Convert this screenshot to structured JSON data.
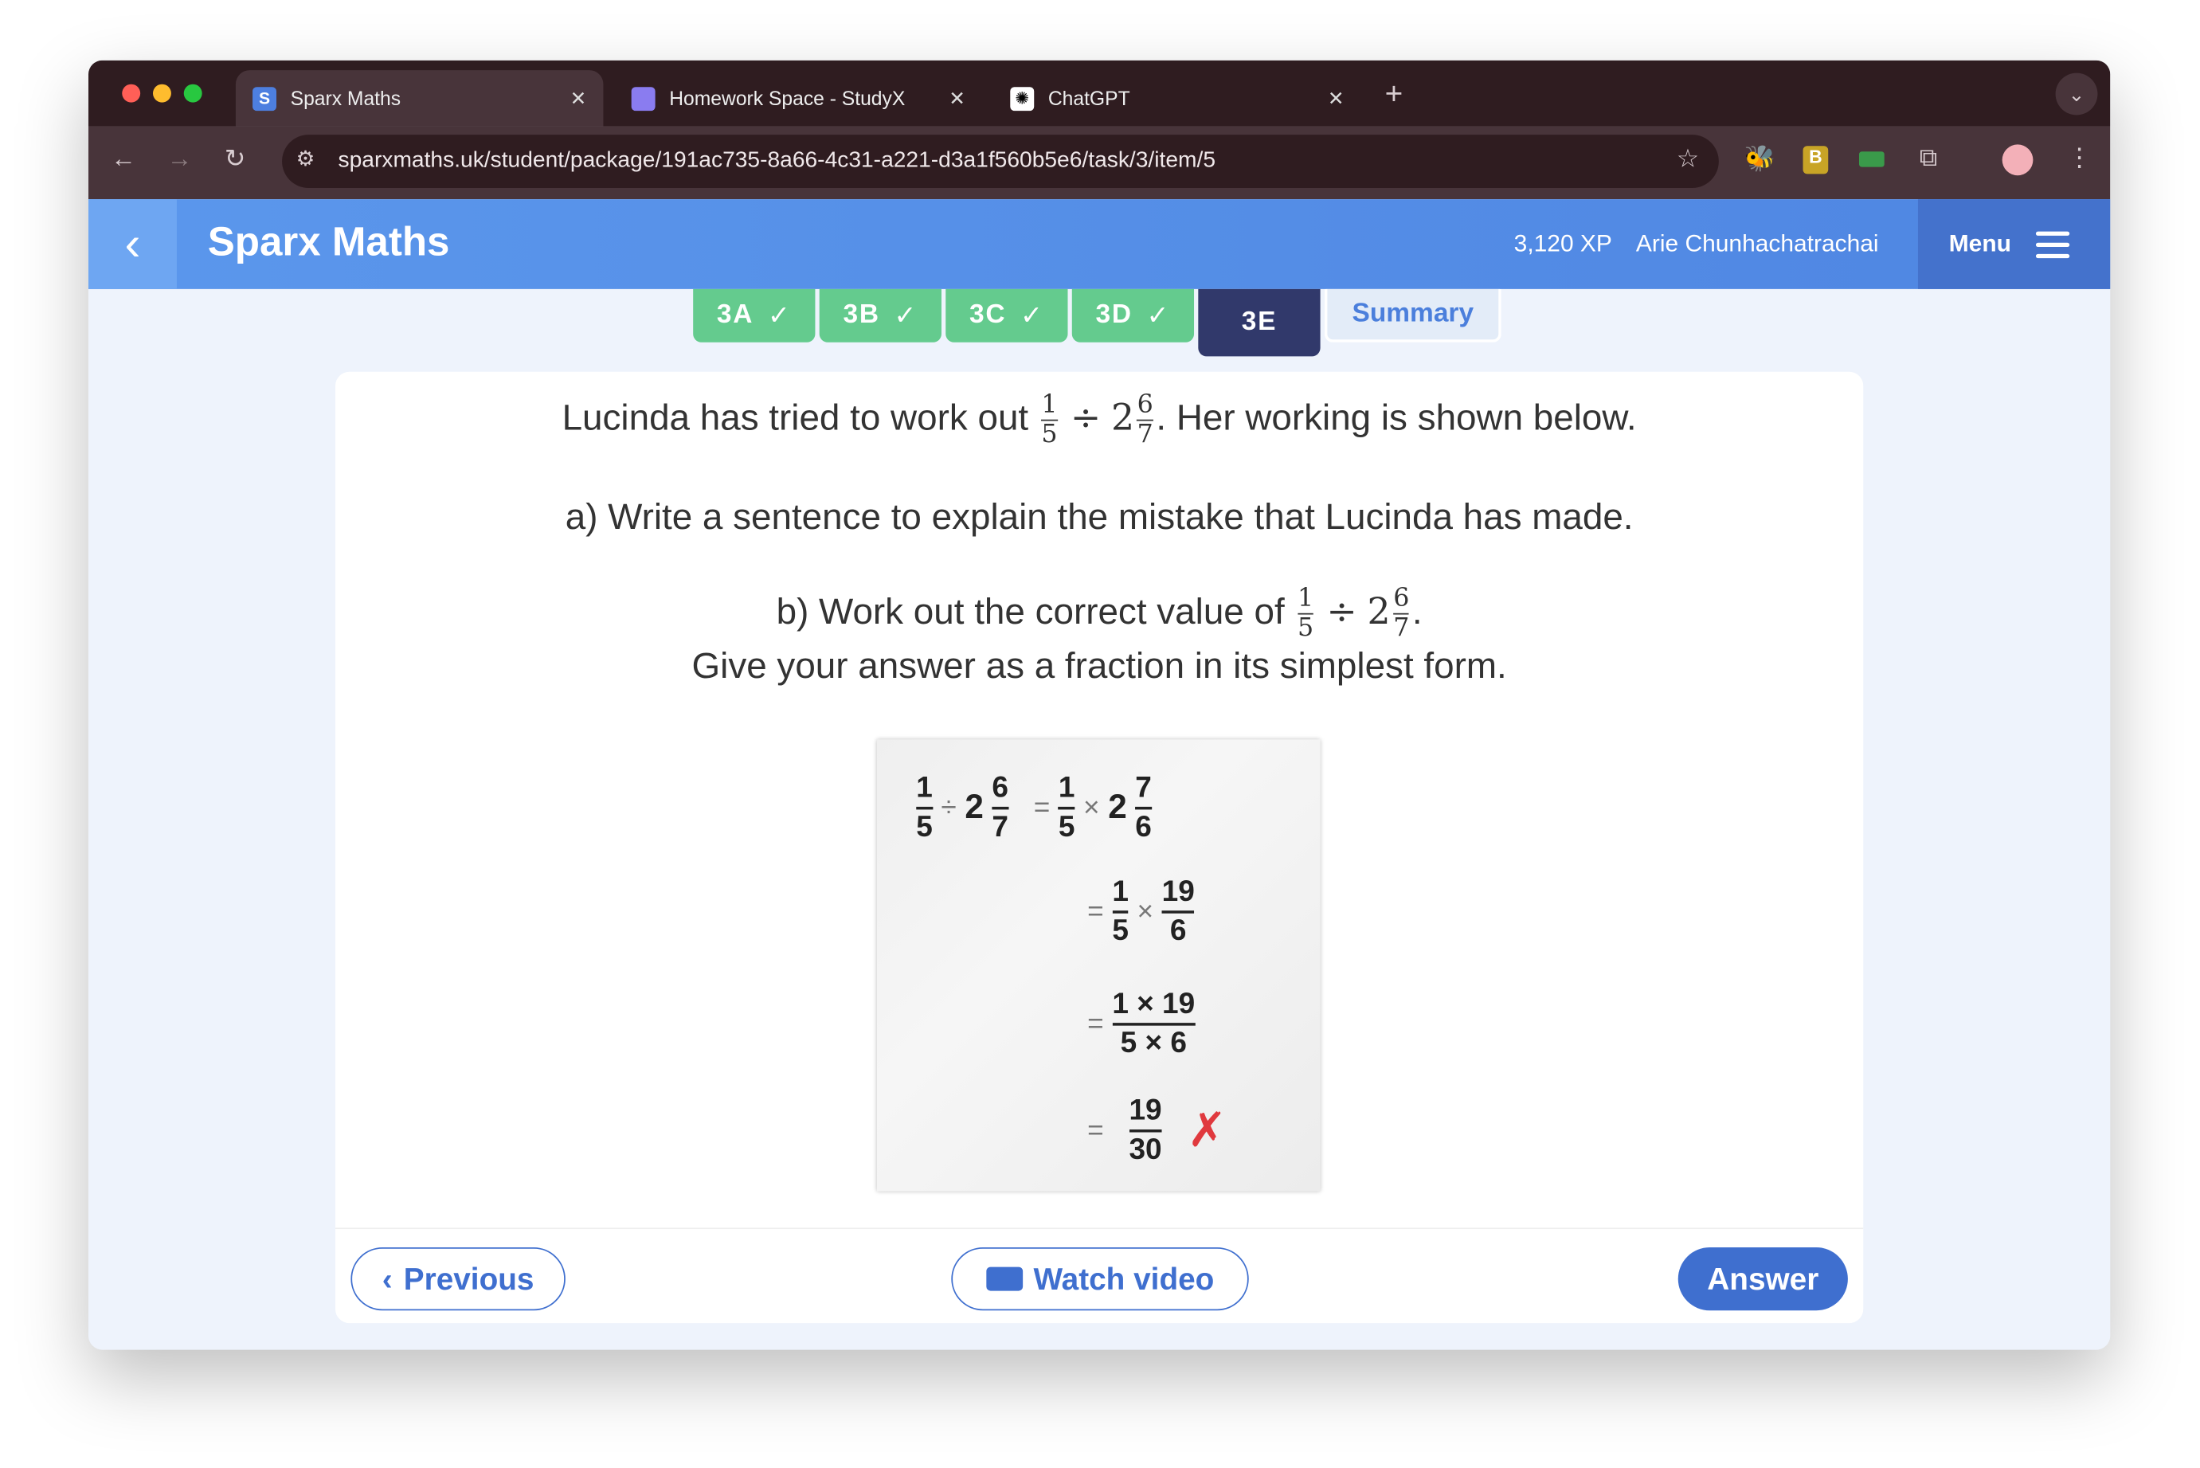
{
  "browser": {
    "tabs": [
      {
        "title": "Sparx Maths",
        "favicon": "S"
      },
      {
        "title": "Homework Space - StudyX"
      },
      {
        "title": "ChatGPT"
      }
    ],
    "url": "sparxmaths.uk/student/package/191ac735-8a66-4c31-a221-d3a1f560b5e6/task/3/item/5"
  },
  "header": {
    "title": "Sparx Maths",
    "xp": "3,120 XP",
    "user": "Arie Chunhachatrachai",
    "menu": "Menu"
  },
  "steps": [
    {
      "label": "3A",
      "done": true
    },
    {
      "label": "3B",
      "done": true
    },
    {
      "label": "3C",
      "done": true
    },
    {
      "label": "3D",
      "done": true
    },
    {
      "label": "3E",
      "current": true
    },
    {
      "label": "Summary"
    }
  ],
  "question": {
    "line1_pre": "Lucinda has tried to work out",
    "line1_post": ". Her working is shown below.",
    "frac_num": "1",
    "frac_den": "5",
    "op": "÷",
    "whole": "2",
    "mixed_num": "6",
    "mixed_den": "7",
    "part_a": "a) Write a sentence to explain the mistake that Lucinda has made.",
    "part_b_pre": "b) Work out the correct value of",
    "part_b_post": ".",
    "part_b_line2": "Give your answer as a fraction in its simplest form."
  },
  "working": {
    "r1": {
      "a_num": "1",
      "a_den": "5",
      "div": "÷",
      "whole": "2",
      "b_num": "6",
      "b_den": "7",
      "eq": "=",
      "c_num": "1",
      "c_den": "5",
      "mul": "×",
      "whole2": "2",
      "d_num": "7",
      "d_den": "6"
    },
    "r2": {
      "eq": "=",
      "a_num": "1",
      "a_den": "5",
      "mul": "×",
      "b_num": "19",
      "b_den": "6"
    },
    "r3": {
      "eq": "=",
      "num": "1 × 19",
      "den": "5 × 6"
    },
    "r4": {
      "eq": "=",
      "num": "19",
      "den": "30",
      "mark": "✗"
    }
  },
  "footer": {
    "previous": "Previous",
    "watch": "Watch video",
    "answer": "Answer"
  },
  "colors": {
    "header": "#5b97ec",
    "done": "#64cb8e",
    "current": "#31396b",
    "answer": "#3f6fcf",
    "wrong": "#e0393e"
  }
}
